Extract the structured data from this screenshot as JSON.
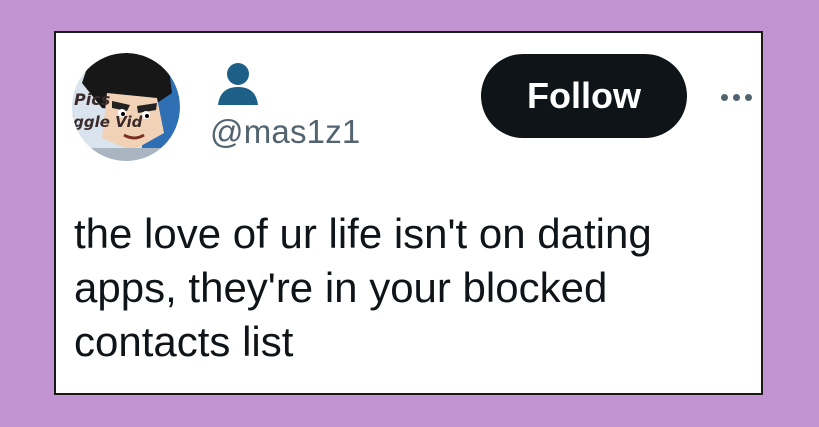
{
  "tweet": {
    "avatar": {
      "overlay_text": [
        "Pics",
        "iggle Vid"
      ]
    },
    "display_name_icon": "person-icon",
    "handle": "@mas1z1",
    "follow_label": "Follow",
    "more_icon": "more-options-icon",
    "text_lines": [
      "the love of ur life isn't on dating",
      "apps, they're in your blocked",
      "contacts list"
    ]
  },
  "colors": {
    "background": "#c193d1",
    "card": "#ffffff",
    "follow_button": "#0f1419",
    "handle": "#536471",
    "person_icon": "#1d5f86"
  }
}
